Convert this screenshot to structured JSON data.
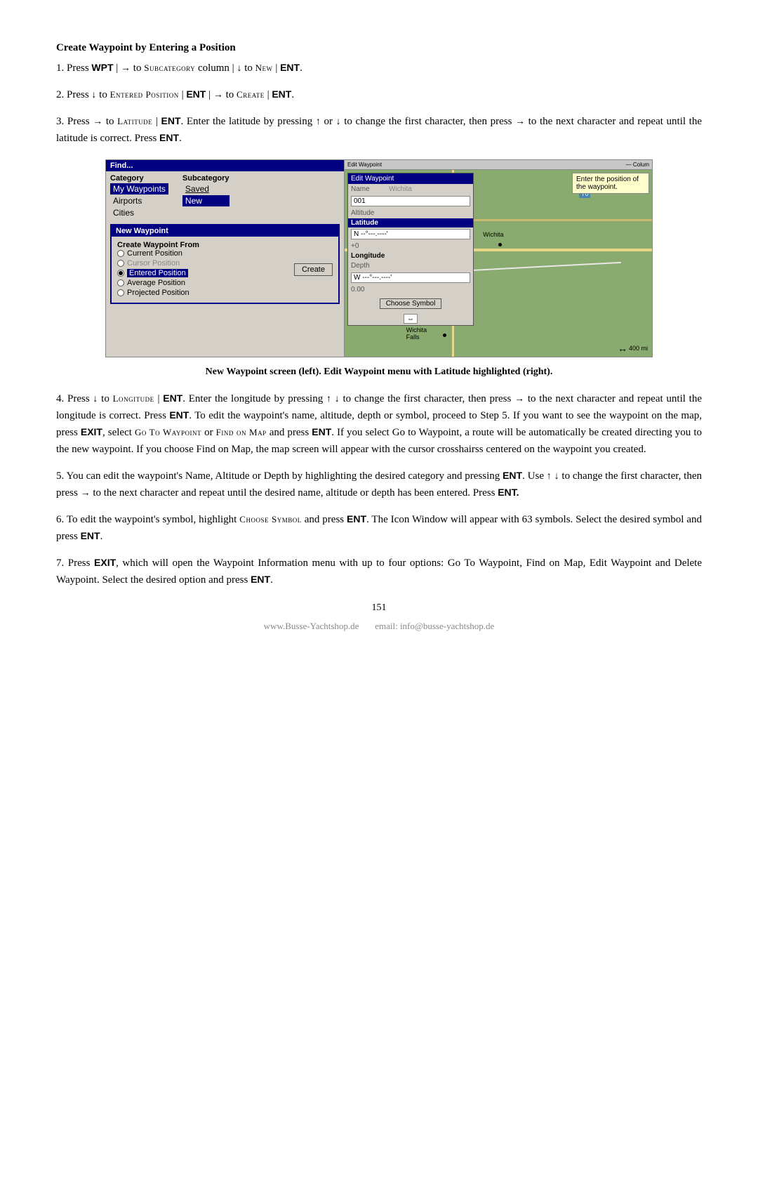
{
  "page": {
    "title": "Create Waypoint by Entering a Position",
    "step1": {
      "text": "1. Press WPT | → to S",
      "rest": "UBCATEGORY",
      "rest2": " column | ↓ to N",
      "rest3": "EW",
      "rest4": " | ENT."
    },
    "step2": {
      "text": "2. Press ↓ to E",
      "entered": "NTERED P",
      "position": "OSITION",
      "rest": " | ENT | → to C",
      "create": "REATE",
      "rest2": " | ENT."
    },
    "step3": {
      "full": "3. Press → to Lᴀᴛɪᴛᴜᴅᴇ | ENT. Enter the latitude by pressing ↑ or ↓ to change the first character, then press → to the next character and repeat until the latitude is correct. Press ENT."
    },
    "caption": "New Waypoint screen (left). Edit Waypoint menu with Latitude highlighted (right).",
    "step4_intro": "4. Press ↓ to L",
    "step4_longitude": "ONGITUDE",
    "step4_rest": " | ENT. Enter the longitude by pressing ↑ ↓ to change the first character, then press → to the next character and repeat until the longitude is correct. Press ENT. To edit the waypoint's name, altitude, depth or symbol, proceed to Step 5. If you want to see the waypoint on the map, press EXIT, select G",
    "step4_goto": "O T",
    "step4_o": "O W",
    "step4_waypoint": "AYPOINT",
    "step4_or": " or F",
    "step4_find": "IND ON M",
    "step4_map": "AP",
    "step4_end": " and press ENT. If you select Go to Waypoint, a route will be automatically be created directing you to the new waypoint. If you choose Find on Map, the map screen will appear with the cursor crosshairss centered on the waypoint you created.",
    "step5": "5. You can edit the waypoint's Name, Altitude or Depth by highlighting the desired category and pressing ENT. Use ↑ ↓ to change the first character, then press → to the next character and repeat until the desired name, altitude or depth has been entered. Press ENT.",
    "step6": "6. To edit the waypoint's symbol, highlight C",
    "step6_choose": "HOOSE S",
    "step6_symbol": "YMBOL",
    "step6_rest": " and press ENT. The Icon Window will appear with 63 symbols. Select the desired symbol and press ENT.",
    "step7": "7. Press EXIT, which will open the Waypoint Information menu with up to four options: Go To Waypoint, Find on Map, Edit Waypoint and Delete Waypoint. Select the desired option and press ENT.",
    "page_number": "151",
    "footer_url": "www.Busse-Yachtshop.de",
    "footer_email": "email: info@busse-yachtshop.de",
    "screenshot": {
      "left": {
        "title": "Find...",
        "col1_header": "Category",
        "col2_header": "Subcategory",
        "categories": [
          "My Waypoints",
          "Airports",
          "Cities"
        ],
        "subcategories": [
          "Saved",
          "New"
        ],
        "popup_title": "New Waypoint",
        "create_from_label": "Create Waypoint From",
        "create_btn": "Create",
        "options": [
          {
            "label": "Current Position",
            "selected": false,
            "gray": false
          },
          {
            "label": "Cursor Position",
            "selected": false,
            "gray": true
          },
          {
            "label": "Entered Position",
            "selected": true,
            "gray": false
          },
          {
            "label": "Average Position",
            "selected": false,
            "gray": false
          },
          {
            "label": "Projected Position",
            "selected": false,
            "gray": false
          }
        ]
      },
      "right": {
        "toolbar": "Edit Waypoint",
        "tooltip": "Enter the position of the waypoint.",
        "name_label": "Name",
        "name_value": "001",
        "altitude_label": "Altitude",
        "altitude_value": "N  --°---.----'",
        "altitude_offset": "+0",
        "longitude_label": "Longitude",
        "longitude_section": "Latitude",
        "depth_label": "Depth",
        "depth_value": "W ---°---.----'",
        "depth_val": "0.00",
        "choose_symbol": "Choose Symbol",
        "wichita_label": "Wichita",
        "wichita_falls": "Wichita Falls",
        "scale": "400 mi"
      }
    }
  }
}
